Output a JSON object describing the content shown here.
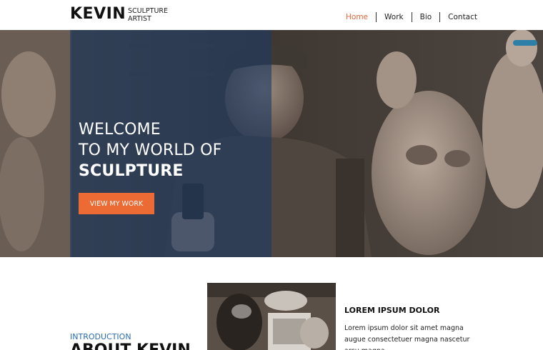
{
  "header": {
    "logo_name": "KEVIN",
    "logo_tagline": [
      "SCULPTURE",
      "ARTIST"
    ],
    "nav": [
      {
        "label": "Home",
        "active": true
      },
      {
        "label": "Work",
        "active": false
      },
      {
        "label": "Bio",
        "active": false
      },
      {
        "label": "Contact",
        "active": false
      }
    ]
  },
  "hero": {
    "lines": [
      "WELCOME",
      "TO MY WORLD OF",
      "SCULPTURE"
    ],
    "button_label": "VIEW MY WORK",
    "image": "sculptor-workshop-photo"
  },
  "intro": {
    "kicker": "INTRODUCTION",
    "title": "ABOUT KEVIN",
    "image": "sculptures-collage-photo",
    "subheading": "LOREM IPSUM DOLOR",
    "body": "Lorem ipsum dolor sit amet magna augue consectetuer magna nascetur arcu magna"
  },
  "colors": {
    "accent": "#ec6a33",
    "nav_active": "#e8663a",
    "overlay_blue": "#1d3a63",
    "kicker_blue": "#2a6cb0"
  }
}
